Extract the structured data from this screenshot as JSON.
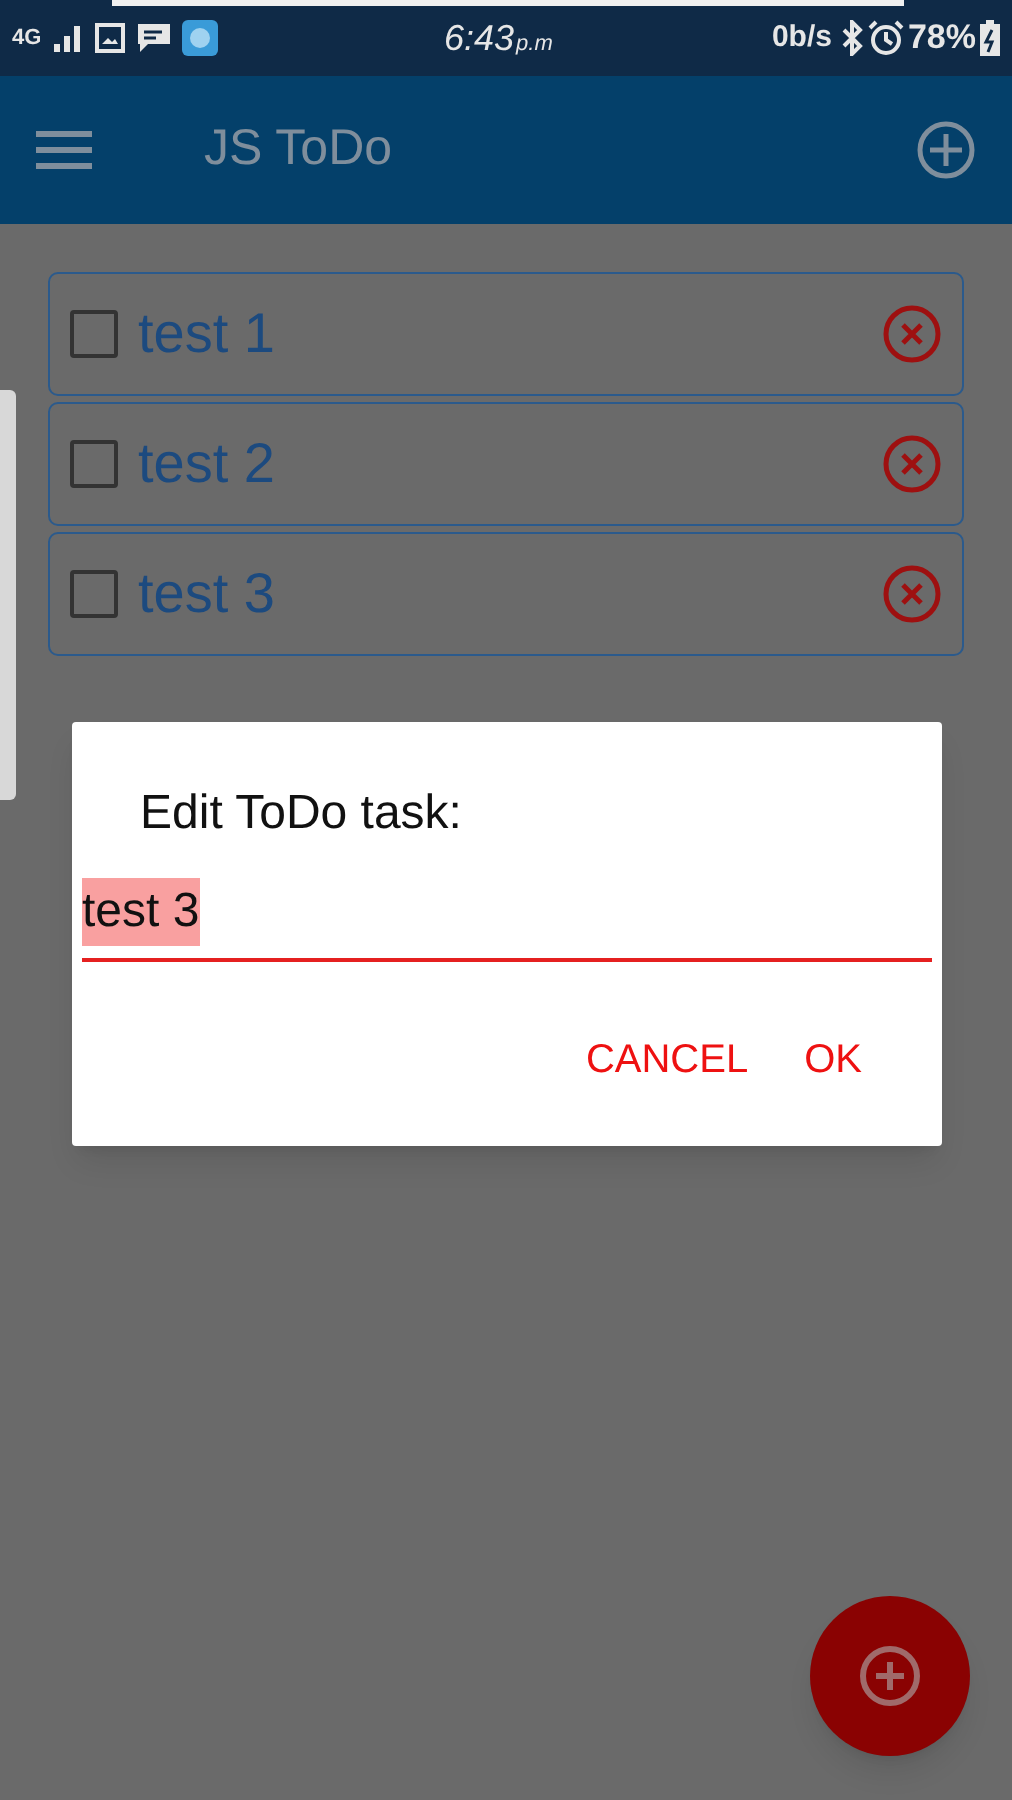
{
  "status_bar": {
    "network": "4G",
    "time": "6:43",
    "time_suffix": "p.m",
    "speed": "0b/s",
    "battery": "78%"
  },
  "app_bar": {
    "title": "JS ToDo"
  },
  "tasks": [
    {
      "text": "test 1",
      "checked": false
    },
    {
      "text": "test 2",
      "checked": false
    },
    {
      "text": "test 3",
      "checked": false
    }
  ],
  "dialog": {
    "title": "Edit ToDo task:",
    "value": "test 3",
    "text_selected": true,
    "buttons": [
      "CANCEL",
      "OK"
    ]
  }
}
